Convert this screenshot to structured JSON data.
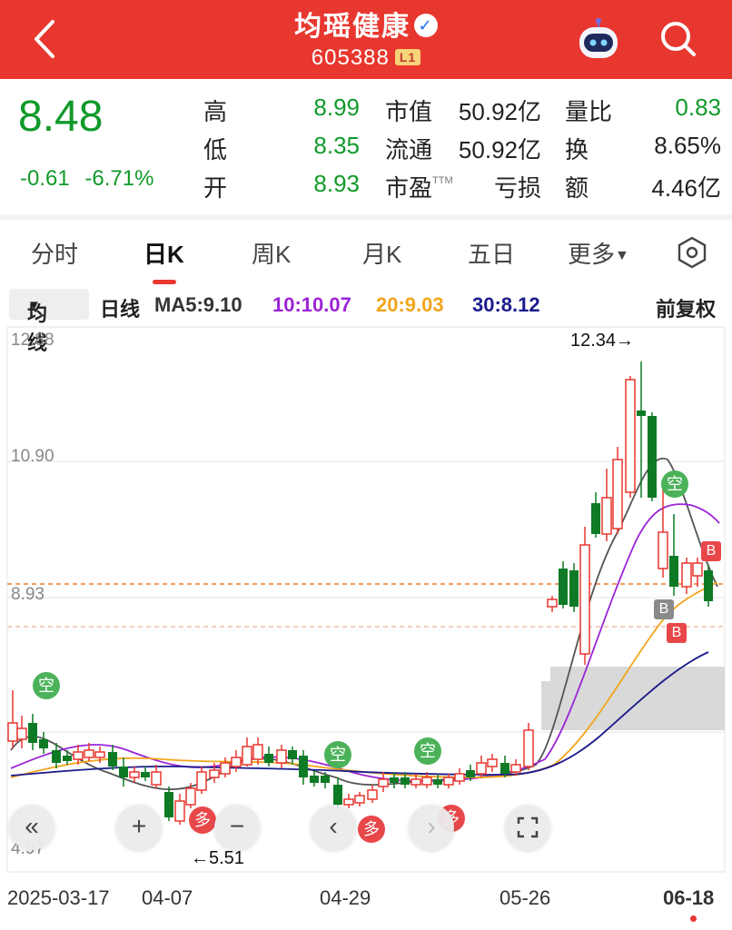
{
  "header": {
    "title": "均瑶健康",
    "verified_icon": "v-verified-badge",
    "code": "605388",
    "level_badge": "L1",
    "background_color": "#e8372f"
  },
  "quote": {
    "price": "8.48",
    "change": "-0.61",
    "change_pct": "-6.71%",
    "down_color": "#119a2a",
    "stats": {
      "high_label": "高",
      "high": "8.99",
      "low_label": "低",
      "low": "8.35",
      "open_label": "开",
      "open": "8.93",
      "mktcap_label": "市值",
      "mktcap": "50.92亿",
      "float_label": "流通",
      "float": "50.92亿",
      "pe_label": "市盈",
      "pe_sup": "TTM",
      "pe": "亏损",
      "vol_ratio_label": "量比",
      "vol_ratio": "0.83",
      "turnover_label": "换",
      "turnover": "8.65%",
      "amount_label": "额",
      "amount": "4.46亿"
    }
  },
  "tabs": [
    {
      "label": "分时"
    },
    {
      "label": "日K",
      "active": true
    },
    {
      "label": "周K"
    },
    {
      "label": "月K"
    },
    {
      "label": "五日"
    },
    {
      "label": "更多"
    }
  ],
  "ma_bar": {
    "indicator": "均线",
    "period": "日线",
    "ma5": "MA5:9.10",
    "ma10": "10:10.07",
    "ma20": "20:9.03",
    "ma30": "30:8.12",
    "adjust": "前复权",
    "colors": {
      "ma5": "#333333",
      "ma10": "#9b24d6",
      "ma20": "#f2a51c",
      "ma30": "#1a1a8c"
    }
  },
  "chart": {
    "y_labels": [
      "12.88",
      "10.90",
      "8.93",
      "4.97"
    ],
    "max_marker": "12.34→",
    "min_marker": "←5.51",
    "signals": {
      "kong": "空",
      "duo": "多",
      "buy": "B"
    },
    "x_labels": [
      "2025-03-17",
      "04-07",
      "04-29",
      "05-26",
      "06-18"
    ],
    "up_color": "#e8372f",
    "down_color": "#0f7a25"
  },
  "controls": {
    "collapse": "«",
    "zoom_in": "+",
    "zoom_out": "−",
    "prev": "‹",
    "next": "›"
  }
}
